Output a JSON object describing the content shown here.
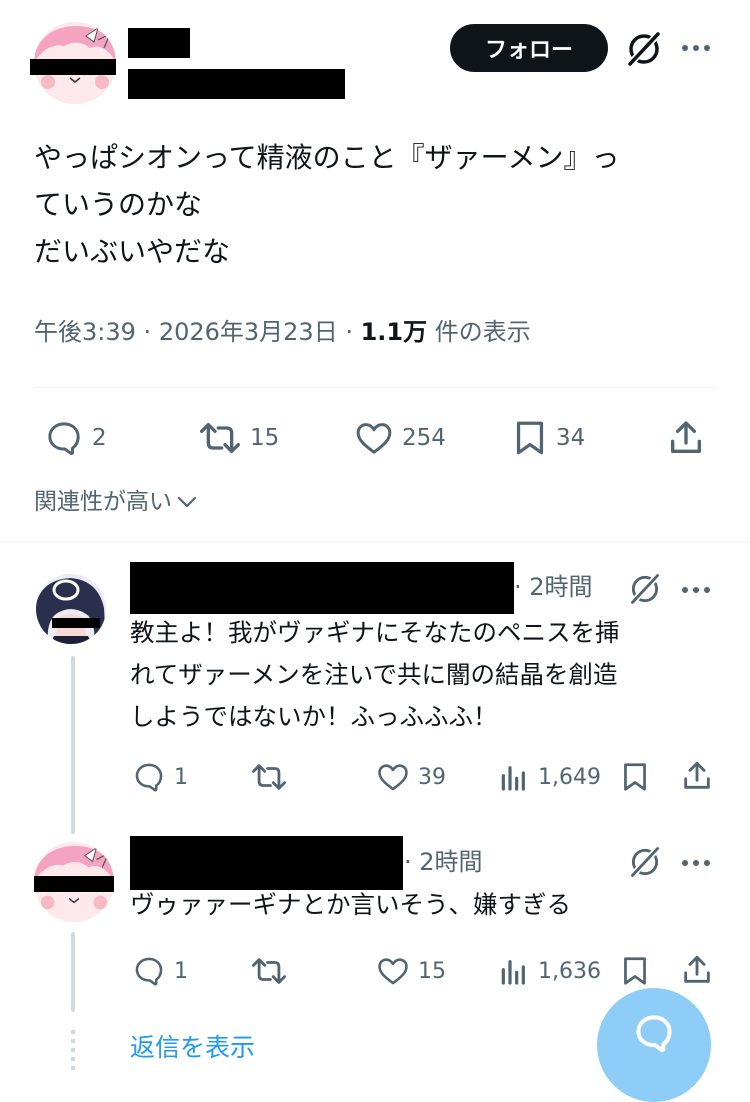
{
  "main_tweet": {
    "follow_label": "フォロー",
    "text_lines": [
      "やっぱシオンって精液のこと『ザァーメン』っ",
      "ていうのかな",
      "だいぶいやだな"
    ],
    "time": "午後3:39",
    "date": "2026年3月23日",
    "views_count": "1.1万",
    "views_label": "件の表示",
    "replies": "2",
    "retweets": "15",
    "likes": "254",
    "bookmarks": "34"
  },
  "sort_label": "関連性が高い",
  "replies": [
    {
      "time": "2時間",
      "text_lines": [
        "教主よ！我がヴァギナにそなたのペニスを挿",
        "れてザァーメンを注いで共に闇の結晶を創造",
        "しようではないか！ふっふふふ！"
      ],
      "replies": "1",
      "likes": "39",
      "views": "1,649"
    },
    {
      "time": "2時間",
      "text_lines": [
        "ヴゥァァーギナとか言いそう、嫌すぎる"
      ],
      "replies": "1",
      "likes": "15",
      "views": "1,636"
    }
  ],
  "show_replies_label": "返信を表示",
  "colors": {
    "accent": "#1d9bf0",
    "text": "#0f1419",
    "muted": "#536471",
    "border": "#eff3f4",
    "fab": "#8ecdf8"
  },
  "icons": {
    "grok": "grok-icon",
    "more": "more-icon",
    "reply": "reply-icon",
    "retweet": "retweet-icon",
    "like": "like-icon",
    "bookmark": "bookmark-icon",
    "share": "share-icon",
    "views": "views-icon",
    "chevron": "chevron-down-icon",
    "compose": "compose-reply-icon"
  }
}
